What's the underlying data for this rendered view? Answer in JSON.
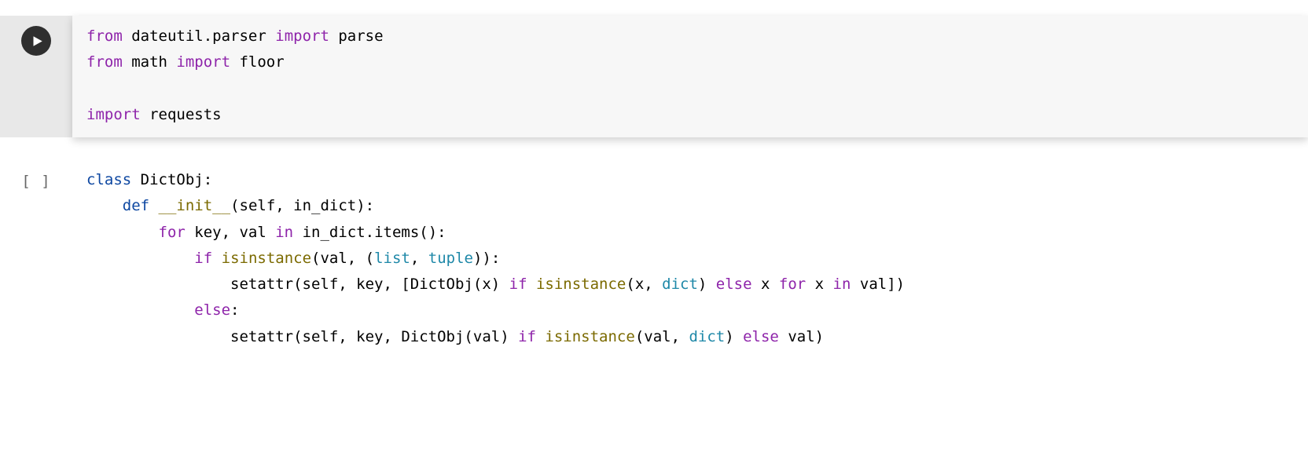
{
  "cells": [
    {
      "prompt_style": "run",
      "tokens": [
        {
          "t": "from",
          "c": "kn"
        },
        {
          "t": " dateutil",
          "c": "nm"
        },
        {
          "t": ".",
          "c": "nm"
        },
        {
          "t": "parser ",
          "c": "nm"
        },
        {
          "t": "import",
          "c": "kn"
        },
        {
          "t": " parse",
          "c": "nm"
        },
        {
          "t": "\n",
          "c": ""
        },
        {
          "t": "from",
          "c": "kn"
        },
        {
          "t": " math ",
          "c": "nm"
        },
        {
          "t": "import",
          "c": "kn"
        },
        {
          "t": " floor",
          "c": "nm"
        },
        {
          "t": "\n",
          "c": ""
        },
        {
          "t": "\n",
          "c": ""
        },
        {
          "t": "import",
          "c": "kn"
        },
        {
          "t": " requests",
          "c": "nm"
        }
      ]
    },
    {
      "prompt_style": "empty",
      "tokens": [
        {
          "t": "class",
          "c": "kb"
        },
        {
          "t": " ",
          "c": ""
        },
        {
          "t": "DictObj",
          "c": "cls"
        },
        {
          "t": ":",
          "c": "nm"
        },
        {
          "t": "\n",
          "c": ""
        },
        {
          "t": "    ",
          "c": ""
        },
        {
          "t": "def",
          "c": "kb"
        },
        {
          "t": " ",
          "c": ""
        },
        {
          "t": "__init__",
          "c": "fn"
        },
        {
          "t": "(",
          "c": "nm"
        },
        {
          "t": "self",
          "c": "nm"
        },
        {
          "t": ", in_dict):",
          "c": "nm"
        },
        {
          "t": "\n",
          "c": ""
        },
        {
          "t": "        ",
          "c": ""
        },
        {
          "t": "for",
          "c": "k"
        },
        {
          "t": " key, val ",
          "c": "nm"
        },
        {
          "t": "in",
          "c": "k"
        },
        {
          "t": " in_dict",
          "c": "nm"
        },
        {
          "t": ".",
          "c": "nm"
        },
        {
          "t": "items():",
          "c": "nm"
        },
        {
          "t": "\n",
          "c": ""
        },
        {
          "t": "            ",
          "c": ""
        },
        {
          "t": "if",
          "c": "k"
        },
        {
          "t": " ",
          "c": ""
        },
        {
          "t": "isinstance",
          "c": "fn"
        },
        {
          "t": "(val, (",
          "c": "nm"
        },
        {
          "t": "list",
          "c": "bi"
        },
        {
          "t": ", ",
          "c": "nm"
        },
        {
          "t": "tuple",
          "c": "bi"
        },
        {
          "t": ")):",
          "c": "nm"
        },
        {
          "t": "\n",
          "c": ""
        },
        {
          "t": "                setattr(self, key, [DictObj(x) ",
          "c": "nm"
        },
        {
          "t": "if",
          "c": "k"
        },
        {
          "t": " ",
          "c": ""
        },
        {
          "t": "isinstance",
          "c": "fn"
        },
        {
          "t": "(x, ",
          "c": "nm"
        },
        {
          "t": "dict",
          "c": "bi"
        },
        {
          "t": ") ",
          "c": "nm"
        },
        {
          "t": "else",
          "c": "k"
        },
        {
          "t": " x ",
          "c": "nm"
        },
        {
          "t": "for",
          "c": "k"
        },
        {
          "t": " x ",
          "c": "nm"
        },
        {
          "t": "in",
          "c": "k"
        },
        {
          "t": " val])",
          "c": "nm"
        },
        {
          "t": "\n",
          "c": ""
        },
        {
          "t": "            ",
          "c": ""
        },
        {
          "t": "else",
          "c": "k"
        },
        {
          "t": ":",
          "c": "nm"
        },
        {
          "t": "\n",
          "c": ""
        },
        {
          "t": "                setattr(self, key, DictObj(val) ",
          "c": "nm"
        },
        {
          "t": "if",
          "c": "k"
        },
        {
          "t": " ",
          "c": ""
        },
        {
          "t": "isinstance",
          "c": "fn"
        },
        {
          "t": "(val, ",
          "c": "nm"
        },
        {
          "t": "dict",
          "c": "bi"
        },
        {
          "t": ") ",
          "c": "nm"
        },
        {
          "t": "else",
          "c": "k"
        },
        {
          "t": " val)",
          "c": "nm"
        }
      ]
    }
  ],
  "prompt_empty": "[ ]"
}
